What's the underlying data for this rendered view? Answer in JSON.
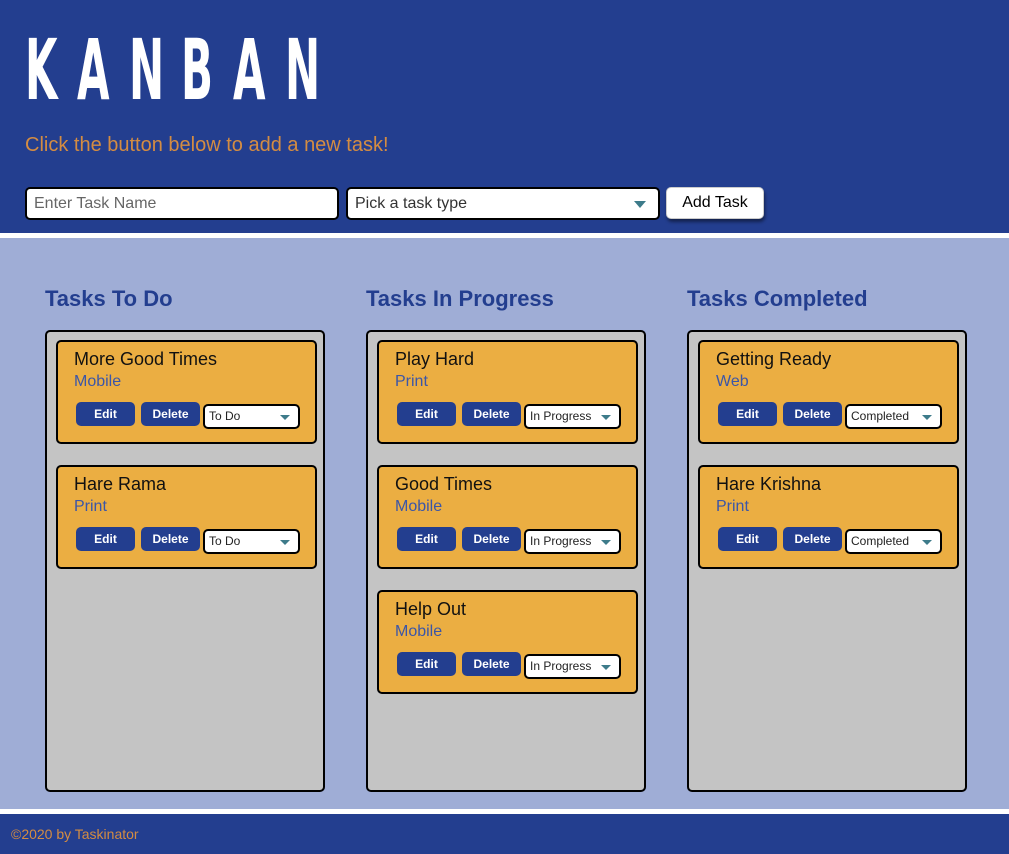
{
  "header": {
    "logo_letters": [
      "K",
      "A",
      "N",
      "B",
      "A",
      "N"
    ],
    "subtitle": "Click the button below to add a new task!",
    "task_input": {
      "placeholder": "Enter Task Name",
      "value": ""
    },
    "type_select": {
      "selected": "Pick a task type"
    },
    "add_button_label": "Add Task"
  },
  "columns": [
    {
      "title": "Tasks To Do",
      "tasks": [
        {
          "name": "More Good Times",
          "type": "Mobile",
          "status": "To Do"
        },
        {
          "name": "Hare Rama",
          "type": "Print",
          "status": "To Do"
        }
      ]
    },
    {
      "title": "Tasks In Progress",
      "tasks": [
        {
          "name": "Play Hard",
          "type": "Print",
          "status": "In Progress"
        },
        {
          "name": "Good Times",
          "type": "Mobile",
          "status": "In Progress"
        },
        {
          "name": "Help Out",
          "type": "Mobile",
          "status": "In Progress"
        }
      ]
    },
    {
      "title": "Tasks Completed",
      "tasks": [
        {
          "name": "Getting Ready",
          "type": "Web",
          "status": "Completed"
        },
        {
          "name": "Hare Krishna",
          "type": "Print",
          "status": "Completed"
        }
      ]
    }
  ],
  "task_buttons": {
    "edit_label": "Edit",
    "delete_label": "Delete"
  },
  "footer": {
    "text": "©2020 by Taskinator"
  },
  "colors": {
    "primary": "#233e8f",
    "accent": "#d48c42",
    "board_background": "#9fadd6",
    "column_background": "#c4c4c4",
    "task_background": "#ebae42"
  }
}
